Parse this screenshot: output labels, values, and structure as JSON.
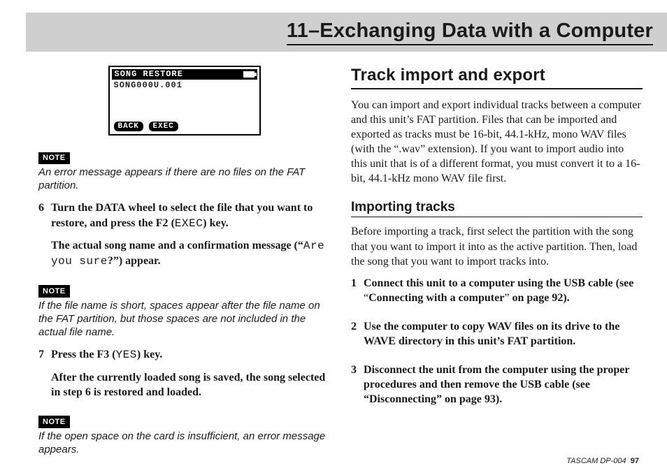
{
  "header": {
    "title": "11–Exchanging Data with a Computer"
  },
  "lcd": {
    "title": "SONG RESTORE",
    "line2": "SONG000U.001",
    "btn_back": "BACK",
    "btn_exec": "EXEC"
  },
  "left": {
    "note1_label": "NOTE",
    "note1_text": "An error message appears if there are no files on the FAT partition.",
    "step6_num": "6",
    "step6_p1a": "Turn the ",
    "step6_p1_data": "DATA",
    "step6_p1b": " wheel to select the file that you want to restore, and press the ",
    "step6_p1_f2": "F2",
    "step6_p1c": " (",
    "step6_p1_exec": "EXEC",
    "step6_p1d": ") key.",
    "step6_p2a": "The actual song name and a confirmation message (“",
    "step6_p2_mono": "Are you sure",
    "step6_p2b": "?”) appear.",
    "note2_label": "NOTE",
    "note2_text": "If the file name is short, spaces appear after the file name on the FAT partition, but those spaces are not included in the actual file name.",
    "step7_num": "7",
    "step7_p1a": "Press the ",
    "step7_p1_f3": "F3",
    "step7_p1b": " (",
    "step7_p1_yes": "YES",
    "step7_p1c": ") key.",
    "step7_p2": "After the currently loaded song is saved, the song selected in step 6 is restored and loaded.",
    "note3_label": "NOTE",
    "note3_text": "If the open space on the card is insufficient, an error message appears."
  },
  "right": {
    "h2": "Track import and export",
    "intro": "You can import and export individual tracks between a computer and this unit’s FAT partition. Files that can be imported and exported as tracks must be 16-bit, 44.1-kHz, mono WAV files (with the “.wav” extension). If you want to import audio into this unit that is of a different format, you must convert it to a 16-bit, 44.1-kHz mono WAV file first.",
    "h3": "Importing tracks",
    "p2": "Before importing a track, first select the partition with the song that you want to import it into as the active partition. Then, load the song that you want to import tracks into.",
    "s1_num": "1",
    "s1a": "Connect this unit to a computer using the USB cable (see ",
    "s1q1": "“",
    "s1_link": "Connecting with a computer",
    "s1q2": "”",
    "s1b": " on page 92).",
    "s2_num": "2",
    "s2": "Use the computer to copy WAV files on its drive to the WAVE directory in this unit’s FAT partition.",
    "s3_num": "3",
    "s3": "Disconnect the unit from the computer using the proper procedures and then remove the USB cable (see “Disconnecting” on page 93)."
  },
  "footer": {
    "brand": "TASCAM  DP-004",
    "page": "97"
  }
}
